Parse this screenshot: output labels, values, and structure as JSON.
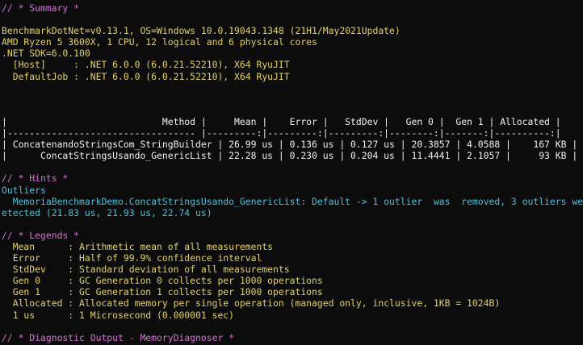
{
  "summary": {
    "header": "// * Summary *",
    "env_lines": [
      "BenchmarkDotNet=v0.13.1, OS=Windows 10.0.19043.1348 (21H1/May2021Update)",
      "AMD Ryzen 5 3600X, 1 CPU, 12 logical and 6 physical cores",
      ".NET SDK=6.0.100",
      "  [Host]     : .NET 6.0.0 (6.0.21.52210), X64 RyuJIT",
      "  DefaultJob : .NET 6.0.0 (6.0.21.52210), X64 RyuJIT"
    ]
  },
  "table": {
    "header": "|                            Method |     Mean |    Error |   StdDev |   Gen 0 |  Gen 1 | Allocated |",
    "separator": "|---------------------------------- |---------:|---------:|---------:|--------:|-------:|----------:|",
    "rows": [
      "| ConcatenandoStringsCom_StringBuilder | 26.99 us | 0.136 us | 0.127 us | 20.3857 | 4.0588 |    167 KB |",
      "|      ConcatStringsUsando_GenericList | 22.28 us | 0.230 us | 0.204 us | 11.4441 | 2.1057 |     93 KB |"
    ]
  },
  "hints": {
    "header": "// * Hints *",
    "lines": [
      "Outliers",
      "  MemoriaBenchmarkDemo.ConcatStringsUsando_GenericList: Default -> 1 outlier  was  removed, 3 outliers were d",
      "etected (21.83 us, 21.93 us, 22.74 us)"
    ]
  },
  "legends": {
    "header": "// * Legends *",
    "lines": [
      "  Mean      : Arithmetic mean of all measurements",
      "  Error     : Half of 99.9% confidence interval",
      "  StdDev    : Standard deviation of all measurements",
      "  Gen 0     : GC Generation 0 collects per 1000 operations",
      "  Gen 1     : GC Generation 1 collects per 1000 operations",
      "  Allocated : Allocated memory per single operation (managed only, inclusive, 1KB = 1024B)",
      "  1 us      : 1 Microsecond (0.000001 sec)"
    ]
  },
  "diagnostic": {
    "header": "// * Diagnostic Output - MemoryDiagnoser *"
  },
  "colors": {
    "background": "#0c0c0c",
    "section_header": "#d670d6",
    "environment": "#e5d266",
    "table": "#f1f1f1",
    "hints": "#4ec0d9",
    "legends": "#e5d266"
  }
}
